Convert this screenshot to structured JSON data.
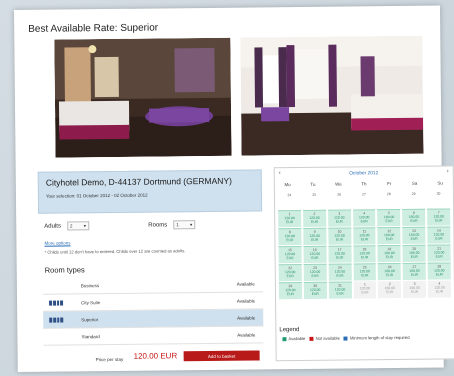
{
  "page": {
    "title": "Best Available Rate: Superior"
  },
  "hotel": {
    "name": "Cityhotel Demo, D-44137 Dortmund (GERMANY)",
    "selection": "Your selection: 01 October 2012 - 02 October 2012"
  },
  "form": {
    "adults_label": "Adults",
    "adults_value": "2",
    "rooms_label": "Rooms",
    "rooms_value": "1",
    "more_options": "More options",
    "note": "* Childs until 12 don't have to entered. Childs over 12 are counted as adults."
  },
  "room_types": {
    "title": "Room types",
    "rows": [
      {
        "name": "Business",
        "status": "Available"
      },
      {
        "name": "City Suite",
        "status": "Available"
      },
      {
        "name": "Superior",
        "status": "Available"
      },
      {
        "name": "Standard",
        "status": "Available"
      }
    ]
  },
  "price": {
    "label": "Price per stay",
    "value": "120.00 EUR",
    "button": "Add to basket"
  },
  "calendar": {
    "month": "October 2012",
    "prev": "‹",
    "next": "›",
    "days": [
      "Mo",
      "Tu",
      "We",
      "Th",
      "Fr",
      "Sa",
      "Su"
    ],
    "weeks": [
      [
        {
          "d": "24",
          "p": "",
          "c": "",
          "s": "gray"
        },
        {
          "d": "25",
          "p": "",
          "c": "",
          "s": "gray"
        },
        {
          "d": "26",
          "p": "",
          "c": "",
          "s": "gray"
        },
        {
          "d": "27",
          "p": "",
          "c": "",
          "s": "gray"
        },
        {
          "d": "28",
          "p": "",
          "c": "",
          "s": "gray"
        },
        {
          "d": "29",
          "p": "",
          "c": "",
          "s": "gray"
        },
        {
          "d": "30",
          "p": "",
          "c": "",
          "s": "gray"
        }
      ],
      [
        {
          "d": "1",
          "p": "120.00",
          "c": "EUR",
          "s": "avail"
        },
        {
          "d": "2",
          "p": "120.00",
          "c": "EUR",
          "s": "avail"
        },
        {
          "d": "3",
          "p": "120.00",
          "c": "EUR",
          "s": "avail"
        },
        {
          "d": "4",
          "p": "120.00",
          "c": "EUR",
          "s": "avail"
        },
        {
          "d": "5",
          "p": "160.00",
          "c": "EUR",
          "s": "avail"
        },
        {
          "d": "6",
          "p": "160.00",
          "c": "EUR",
          "s": "avail"
        },
        {
          "d": "7",
          "p": "120.00",
          "c": "EUR",
          "s": "avail"
        }
      ],
      [
        {
          "d": "8",
          "p": "120.00",
          "c": "EUR",
          "s": "avail"
        },
        {
          "d": "9",
          "p": "120.00",
          "c": "EUR",
          "s": "avail"
        },
        {
          "d": "10",
          "p": "120.00",
          "c": "EUR",
          "s": "avail"
        },
        {
          "d": "11",
          "p": "120.00",
          "c": "EUR",
          "s": "avail"
        },
        {
          "d": "12",
          "p": "160.00",
          "c": "EUR",
          "s": "avail"
        },
        {
          "d": "13",
          "p": "160.00",
          "c": "EUR",
          "s": "avail"
        },
        {
          "d": "14",
          "p": "120.00",
          "c": "EUR",
          "s": "avail"
        }
      ],
      [
        {
          "d": "15",
          "p": "120.00",
          "c": "EUR",
          "s": "avail"
        },
        {
          "d": "16",
          "p": "120.00",
          "c": "EUR",
          "s": "avail"
        },
        {
          "d": "17",
          "p": "120.00",
          "c": "EUR",
          "s": "avail"
        },
        {
          "d": "18",
          "p": "120.00",
          "c": "EUR",
          "s": "avail"
        },
        {
          "d": "19",
          "p": "160.00",
          "c": "EUR",
          "s": "avail"
        },
        {
          "d": "20",
          "p": "160.00",
          "c": "EUR",
          "s": "avail"
        },
        {
          "d": "21",
          "p": "120.00",
          "c": "EUR",
          "s": "avail"
        }
      ],
      [
        {
          "d": "22",
          "p": "120.00",
          "c": "EUR",
          "s": "avail"
        },
        {
          "d": "23",
          "p": "120.00",
          "c": "EUR",
          "s": "avail"
        },
        {
          "d": "24",
          "p": "120.00",
          "c": "EUR",
          "s": "avail"
        },
        {
          "d": "25",
          "p": "120.00",
          "c": "EUR",
          "s": "avail"
        },
        {
          "d": "26",
          "p": "160.00",
          "c": "EUR",
          "s": "avail"
        },
        {
          "d": "27",
          "p": "160.00",
          "c": "EUR",
          "s": "avail"
        },
        {
          "d": "28",
          "p": "120.00",
          "c": "EUR",
          "s": "avail"
        }
      ],
      [
        {
          "d": "29",
          "p": "120.00",
          "c": "EUR",
          "s": "avail"
        },
        {
          "d": "30",
          "p": "120.00",
          "c": "EUR",
          "s": "avail"
        },
        {
          "d": "31",
          "p": "120.00",
          "c": "EUR",
          "s": "avail"
        },
        {
          "d": "1",
          "p": "120.00",
          "c": "EUR",
          "s": "other"
        },
        {
          "d": "2",
          "p": "160.00",
          "c": "EUR",
          "s": "other"
        },
        {
          "d": "3",
          "p": "160.00",
          "c": "EUR",
          "s": "other"
        },
        {
          "d": "4",
          "p": "120.00",
          "c": "EUR",
          "s": "other"
        }
      ]
    ]
  },
  "legend": {
    "title": "Legend",
    "available": "Available",
    "not_available": "Not available",
    "min_stay": "Minimum length of stay required",
    "colors": {
      "available": "#1f9a6e",
      "not_available": "#c81818",
      "min_stay": "#2a6db5"
    }
  }
}
